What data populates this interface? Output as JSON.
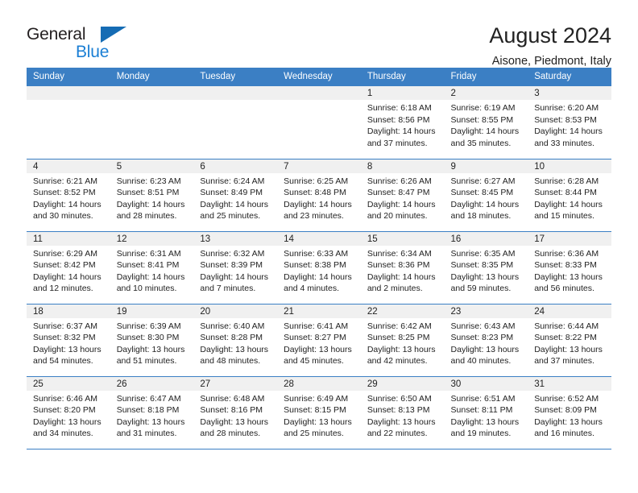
{
  "brand": {
    "name_part1": "General",
    "name_part2": "Blue",
    "accent_color": "#1b7fd4",
    "triangle_icon": "triangle-icon"
  },
  "header": {
    "title": "August 2024",
    "subtitle": "Aisone, Piedmont, Italy"
  },
  "calendar": {
    "header_bg": "#3b7fc4",
    "daynum_bg": "#f0f0f0",
    "weekday_headers": [
      "Sunday",
      "Monday",
      "Tuesday",
      "Wednesday",
      "Thursday",
      "Friday",
      "Saturday"
    ],
    "weeks": [
      [
        {
          "day": "",
          "sunrise": "",
          "sunset": "",
          "daylight": ""
        },
        {
          "day": "",
          "sunrise": "",
          "sunset": "",
          "daylight": ""
        },
        {
          "day": "",
          "sunrise": "",
          "sunset": "",
          "daylight": ""
        },
        {
          "day": "",
          "sunrise": "",
          "sunset": "",
          "daylight": ""
        },
        {
          "day": "1",
          "sunrise": "Sunrise: 6:18 AM",
          "sunset": "Sunset: 8:56 PM",
          "daylight": "Daylight: 14 hours and 37 minutes."
        },
        {
          "day": "2",
          "sunrise": "Sunrise: 6:19 AM",
          "sunset": "Sunset: 8:55 PM",
          "daylight": "Daylight: 14 hours and 35 minutes."
        },
        {
          "day": "3",
          "sunrise": "Sunrise: 6:20 AM",
          "sunset": "Sunset: 8:53 PM",
          "daylight": "Daylight: 14 hours and 33 minutes."
        }
      ],
      [
        {
          "day": "4",
          "sunrise": "Sunrise: 6:21 AM",
          "sunset": "Sunset: 8:52 PM",
          "daylight": "Daylight: 14 hours and 30 minutes."
        },
        {
          "day": "5",
          "sunrise": "Sunrise: 6:23 AM",
          "sunset": "Sunset: 8:51 PM",
          "daylight": "Daylight: 14 hours and 28 minutes."
        },
        {
          "day": "6",
          "sunrise": "Sunrise: 6:24 AM",
          "sunset": "Sunset: 8:49 PM",
          "daylight": "Daylight: 14 hours and 25 minutes."
        },
        {
          "day": "7",
          "sunrise": "Sunrise: 6:25 AM",
          "sunset": "Sunset: 8:48 PM",
          "daylight": "Daylight: 14 hours and 23 minutes."
        },
        {
          "day": "8",
          "sunrise": "Sunrise: 6:26 AM",
          "sunset": "Sunset: 8:47 PM",
          "daylight": "Daylight: 14 hours and 20 minutes."
        },
        {
          "day": "9",
          "sunrise": "Sunrise: 6:27 AM",
          "sunset": "Sunset: 8:45 PM",
          "daylight": "Daylight: 14 hours and 18 minutes."
        },
        {
          "day": "10",
          "sunrise": "Sunrise: 6:28 AM",
          "sunset": "Sunset: 8:44 PM",
          "daylight": "Daylight: 14 hours and 15 minutes."
        }
      ],
      [
        {
          "day": "11",
          "sunrise": "Sunrise: 6:29 AM",
          "sunset": "Sunset: 8:42 PM",
          "daylight": "Daylight: 14 hours and 12 minutes."
        },
        {
          "day": "12",
          "sunrise": "Sunrise: 6:31 AM",
          "sunset": "Sunset: 8:41 PM",
          "daylight": "Daylight: 14 hours and 10 minutes."
        },
        {
          "day": "13",
          "sunrise": "Sunrise: 6:32 AM",
          "sunset": "Sunset: 8:39 PM",
          "daylight": "Daylight: 14 hours and 7 minutes."
        },
        {
          "day": "14",
          "sunrise": "Sunrise: 6:33 AM",
          "sunset": "Sunset: 8:38 PM",
          "daylight": "Daylight: 14 hours and 4 minutes."
        },
        {
          "day": "15",
          "sunrise": "Sunrise: 6:34 AM",
          "sunset": "Sunset: 8:36 PM",
          "daylight": "Daylight: 14 hours and 2 minutes."
        },
        {
          "day": "16",
          "sunrise": "Sunrise: 6:35 AM",
          "sunset": "Sunset: 8:35 PM",
          "daylight": "Daylight: 13 hours and 59 minutes."
        },
        {
          "day": "17",
          "sunrise": "Sunrise: 6:36 AM",
          "sunset": "Sunset: 8:33 PM",
          "daylight": "Daylight: 13 hours and 56 minutes."
        }
      ],
      [
        {
          "day": "18",
          "sunrise": "Sunrise: 6:37 AM",
          "sunset": "Sunset: 8:32 PM",
          "daylight": "Daylight: 13 hours and 54 minutes."
        },
        {
          "day": "19",
          "sunrise": "Sunrise: 6:39 AM",
          "sunset": "Sunset: 8:30 PM",
          "daylight": "Daylight: 13 hours and 51 minutes."
        },
        {
          "day": "20",
          "sunrise": "Sunrise: 6:40 AM",
          "sunset": "Sunset: 8:28 PM",
          "daylight": "Daylight: 13 hours and 48 minutes."
        },
        {
          "day": "21",
          "sunrise": "Sunrise: 6:41 AM",
          "sunset": "Sunset: 8:27 PM",
          "daylight": "Daylight: 13 hours and 45 minutes."
        },
        {
          "day": "22",
          "sunrise": "Sunrise: 6:42 AM",
          "sunset": "Sunset: 8:25 PM",
          "daylight": "Daylight: 13 hours and 42 minutes."
        },
        {
          "day": "23",
          "sunrise": "Sunrise: 6:43 AM",
          "sunset": "Sunset: 8:23 PM",
          "daylight": "Daylight: 13 hours and 40 minutes."
        },
        {
          "day": "24",
          "sunrise": "Sunrise: 6:44 AM",
          "sunset": "Sunset: 8:22 PM",
          "daylight": "Daylight: 13 hours and 37 minutes."
        }
      ],
      [
        {
          "day": "25",
          "sunrise": "Sunrise: 6:46 AM",
          "sunset": "Sunset: 8:20 PM",
          "daylight": "Daylight: 13 hours and 34 minutes."
        },
        {
          "day": "26",
          "sunrise": "Sunrise: 6:47 AM",
          "sunset": "Sunset: 8:18 PM",
          "daylight": "Daylight: 13 hours and 31 minutes."
        },
        {
          "day": "27",
          "sunrise": "Sunrise: 6:48 AM",
          "sunset": "Sunset: 8:16 PM",
          "daylight": "Daylight: 13 hours and 28 minutes."
        },
        {
          "day": "28",
          "sunrise": "Sunrise: 6:49 AM",
          "sunset": "Sunset: 8:15 PM",
          "daylight": "Daylight: 13 hours and 25 minutes."
        },
        {
          "day": "29",
          "sunrise": "Sunrise: 6:50 AM",
          "sunset": "Sunset: 8:13 PM",
          "daylight": "Daylight: 13 hours and 22 minutes."
        },
        {
          "day": "30",
          "sunrise": "Sunrise: 6:51 AM",
          "sunset": "Sunset: 8:11 PM",
          "daylight": "Daylight: 13 hours and 19 minutes."
        },
        {
          "day": "31",
          "sunrise": "Sunrise: 6:52 AM",
          "sunset": "Sunset: 8:09 PM",
          "daylight": "Daylight: 13 hours and 16 minutes."
        }
      ]
    ]
  }
}
